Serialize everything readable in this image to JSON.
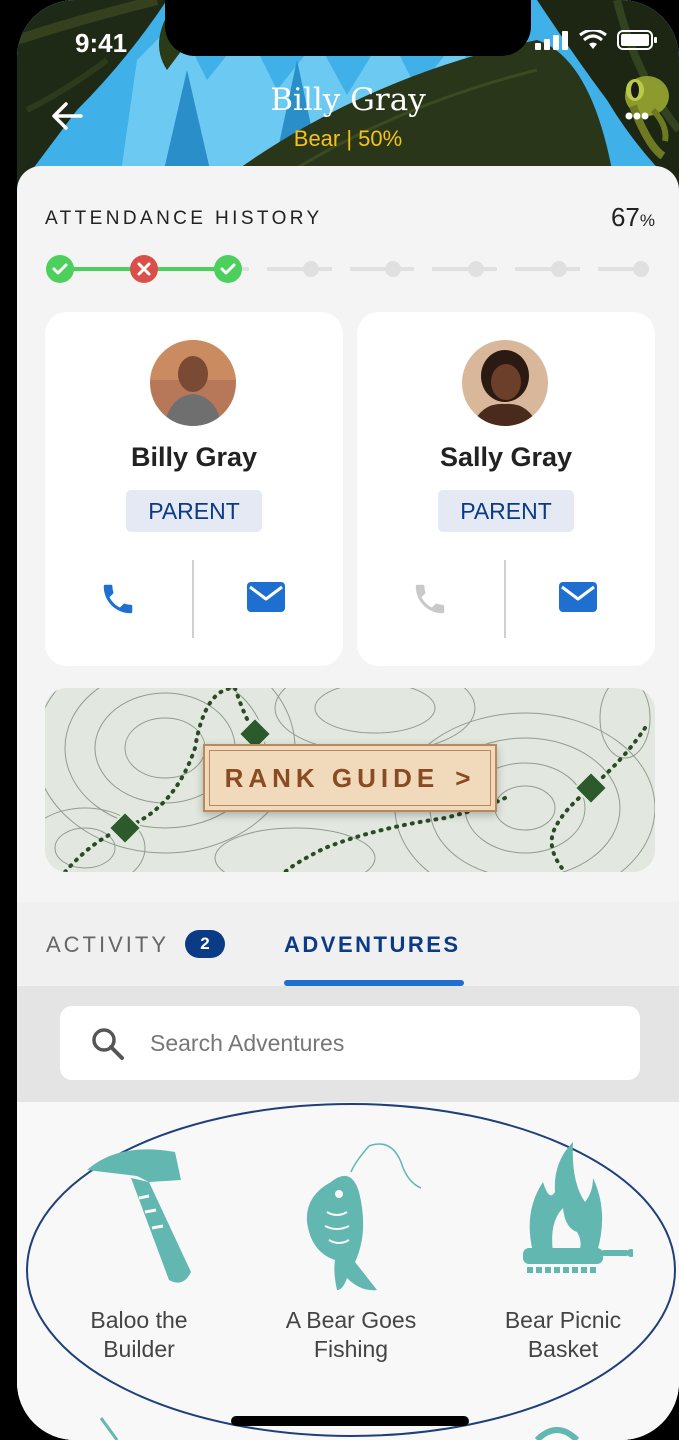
{
  "status_bar": {
    "time": "9:41"
  },
  "header": {
    "title": "Billy Gray",
    "subtitle": "Bear | 50%"
  },
  "attendance": {
    "label": "ATTENDANCE HISTORY",
    "percent_value": "67",
    "percent_sign": "%",
    "steps": [
      "attended",
      "missed",
      "attended",
      "none",
      "none",
      "none",
      "none",
      "none"
    ]
  },
  "contacts": [
    {
      "name": "Billy Gray",
      "role": "PARENT",
      "phone_enabled": true,
      "email_enabled": true
    },
    {
      "name": "Sally Gray",
      "role": "PARENT",
      "phone_enabled": false,
      "email_enabled": true
    }
  ],
  "rank_guide": {
    "label": "RANK GUIDE",
    "chevron": ">"
  },
  "tabs": {
    "activity": {
      "label": "ACTIVITY",
      "count": "2"
    },
    "adventures": {
      "label": "ADVENTURES"
    }
  },
  "search": {
    "placeholder": "Search Adventures"
  },
  "adventures": [
    {
      "line1": "Baloo the",
      "line2": "Builder",
      "icon": "hammer-icon"
    },
    {
      "line1": "A Bear Goes",
      "line2": "Fishing",
      "icon": "fish-icon"
    },
    {
      "line1": "Bear Picnic",
      "line2": "Basket",
      "icon": "campfire-pan-icon"
    }
  ],
  "colors": {
    "accent_blue": "#0b3b86",
    "link_blue": "#1f6fd1",
    "subtitle_yellow": "#f5c21a",
    "success_green": "#4ccf5d",
    "danger_red": "#d9504a",
    "adventure_teal": "#62b7b1"
  }
}
